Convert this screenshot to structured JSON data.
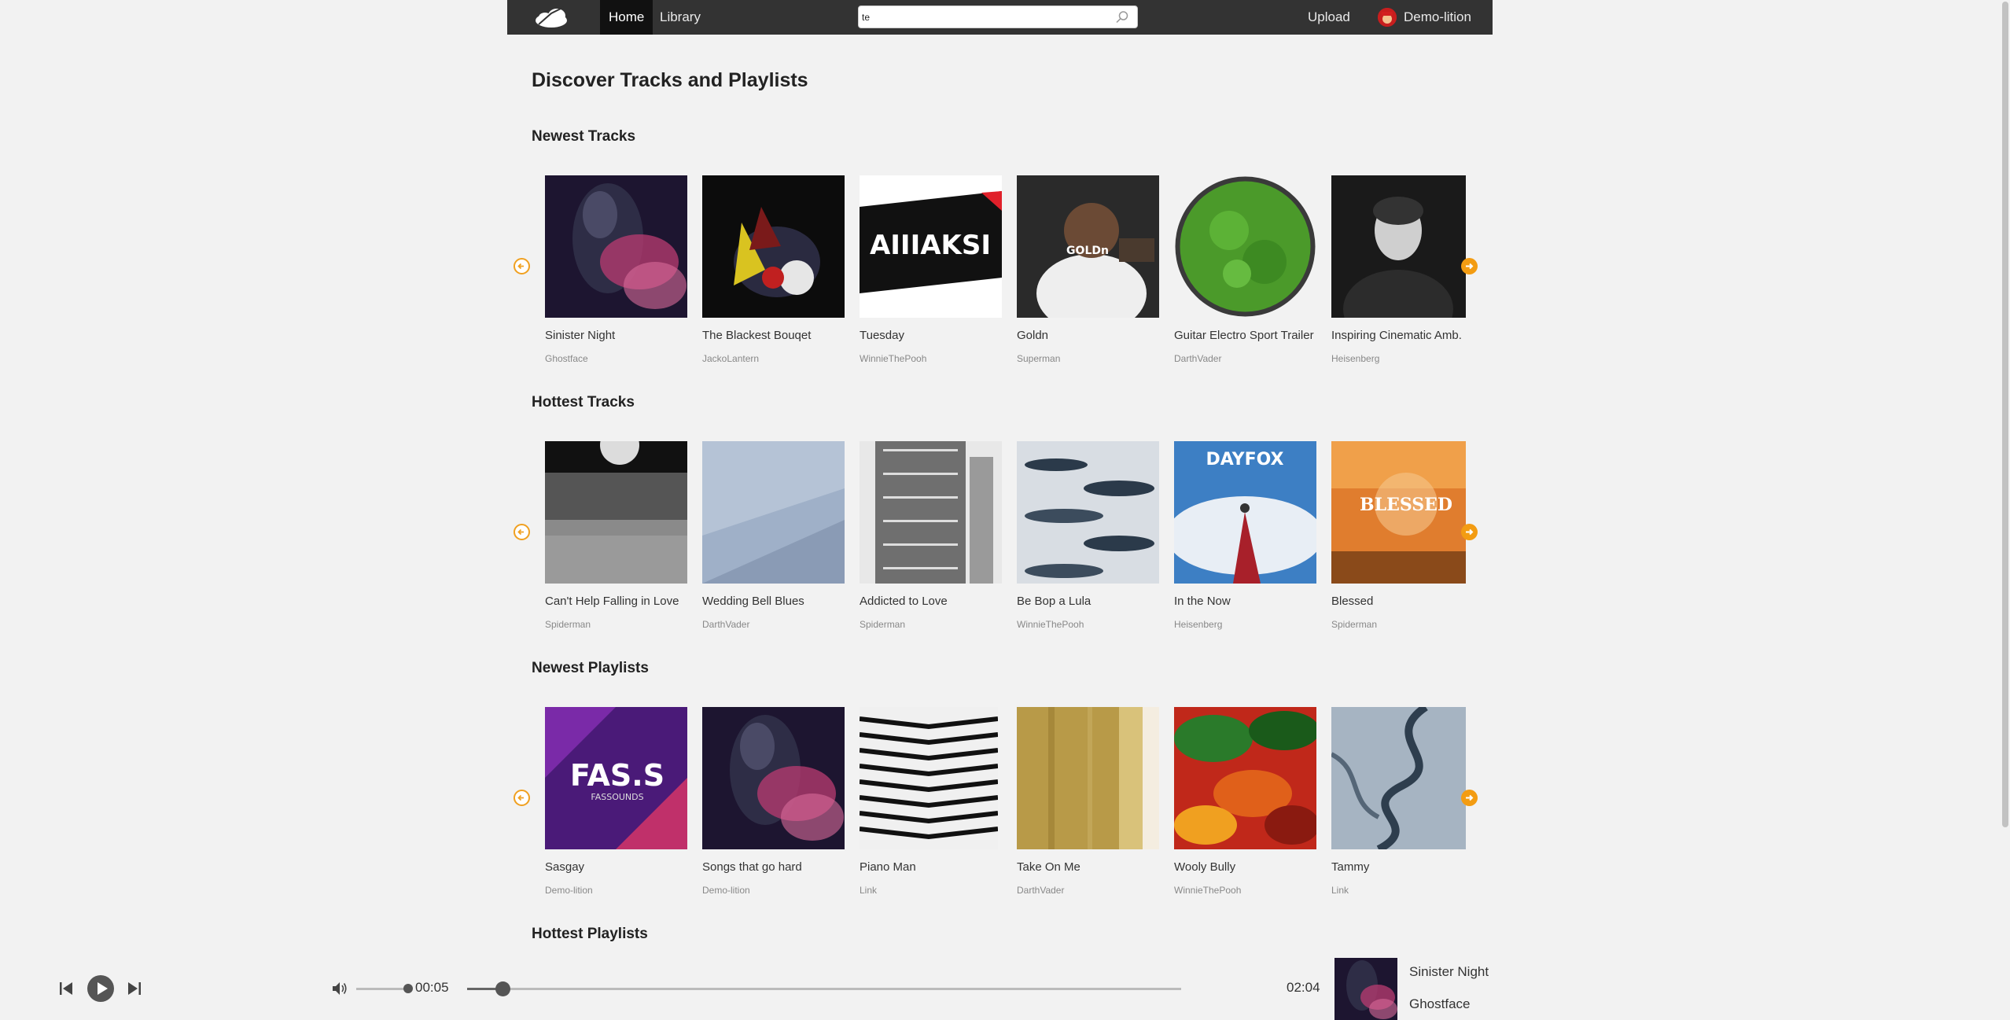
{
  "nav": {
    "home": "Home",
    "library": "Library",
    "search_value": "te",
    "upload": "Upload",
    "user": "Demo-lition"
  },
  "page_title": "Discover Tracks and Playlists",
  "sections": [
    {
      "title": "Newest Tracks",
      "items": [
        {
          "title": "Sinister Night",
          "artist": "Ghostface"
        },
        {
          "title": "The Blackest Bouqet",
          "artist": "JackoLantern"
        },
        {
          "title": "Tuesday",
          "artist": "WinnieThePooh"
        },
        {
          "title": "Goldn",
          "artist": "Superman"
        },
        {
          "title": "Guitar Electro Sport Trailer",
          "artist": "DarthVader"
        },
        {
          "title": "Inspiring Cinematic Amb.",
          "artist": "Heisenberg"
        }
      ]
    },
    {
      "title": "Hottest Tracks",
      "items": [
        {
          "title": "Can't Help Falling in Love",
          "artist": "Spiderman"
        },
        {
          "title": "Wedding Bell Blues",
          "artist": "DarthVader"
        },
        {
          "title": "Addicted to Love",
          "artist": "Spiderman"
        },
        {
          "title": "Be Bop a Lula",
          "artist": "WinnieThePooh"
        },
        {
          "title": "In the Now",
          "artist": "Heisenberg"
        },
        {
          "title": "Blessed",
          "artist": "Spiderman"
        }
      ]
    },
    {
      "title": "Newest Playlists",
      "items": [
        {
          "title": "Sasgay",
          "artist": "Demo-lition"
        },
        {
          "title": "Songs that go hard",
          "artist": "Demo-lition"
        },
        {
          "title": "Piano Man",
          "artist": "Link"
        },
        {
          "title": "Take On Me",
          "artist": "DarthVader"
        },
        {
          "title": "Wooly Bully",
          "artist": "WinnieThePooh"
        },
        {
          "title": "Tammy",
          "artist": "Link"
        }
      ]
    },
    {
      "title": "Hottest Playlists",
      "items": []
    }
  ],
  "cover_art_text": {
    "tuesday": "AIIIAKSI",
    "goldn": "GOLDn",
    "in_the_now": "DAYFOX",
    "blessed": "BLESSED",
    "sasgay_main": "FAS.S",
    "sasgay_sub": "FASSOUNDS"
  },
  "player": {
    "current_time": "00:05",
    "total_time": "02:04",
    "progress": 0.05,
    "volume": 0.9,
    "now_playing_title": "Sinister Night",
    "now_playing_artist": "Ghostface"
  },
  "colors": {
    "accent": "#f39c12",
    "navbar": "#333333",
    "background": "#f2f2f2"
  }
}
